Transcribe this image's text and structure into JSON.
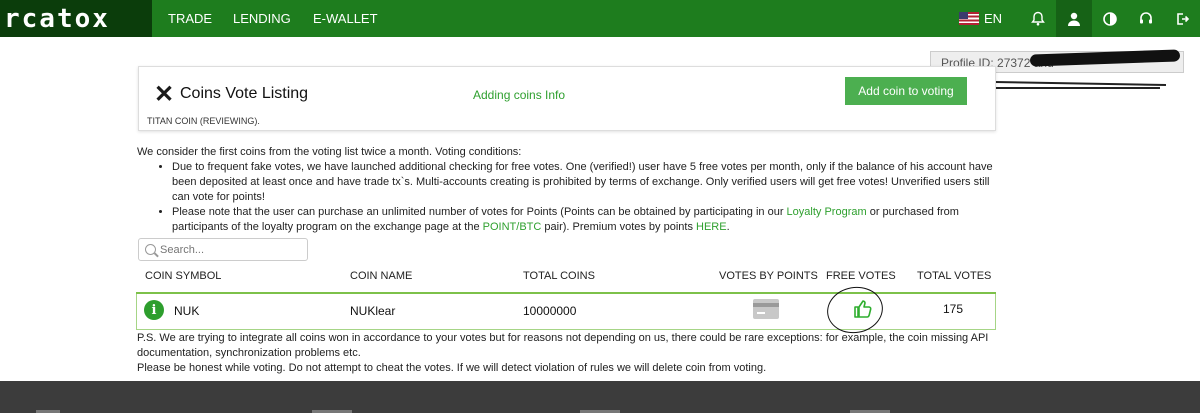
{
  "header": {
    "logo": "rcatox",
    "nav": [
      "TRADE",
      "LENDING",
      "E-WALLET"
    ],
    "lang": "EN",
    "icons": [
      "bell-icon",
      "user-icon",
      "contrast-icon",
      "headset-icon",
      "logout-icon"
    ]
  },
  "profile": {
    "text": "Profile ID: 27372 and"
  },
  "card": {
    "title": "Coins Vote Listing",
    "info_link": "Adding coins Info",
    "add_button": "Add coin to voting",
    "reviewing": "TITAN COIN (REVIEWING)."
  },
  "conditions": {
    "intro": "We consider the first coins from the voting list twice a month. Voting conditions:",
    "bullet1": "Due to frequent fake votes, we have launched additional checking for free votes. One (verified!) user have 5 free votes per month, only if the balance of his account have been deposited at least once and have trade tx`s. Multi-accounts creating is prohibited by terms of exchange. Only verified users will get free votes! Unverified users still can vote for points!",
    "bullet2_a": "Please note that the user can purchase an unlimited number of votes for Points (Points can be obtained by participating in our",
    "bullet2_link1": "Loyalty Program",
    "bullet2_b": "or purchased from participants of the loyalty program on the exchange page at the",
    "bullet2_link2": "POINT/BTC",
    "bullet2_c": "pair). Premium votes by points",
    "bullet2_link3": "HERE",
    "bullet2_d": "."
  },
  "search": {
    "placeholder": "Search..."
  },
  "table": {
    "headers": [
      "COIN SYMBOL",
      "COIN NAME",
      "TOTAL COINS",
      "VOTES BY POINTS",
      "FREE VOTES",
      "TOTAL VOTES"
    ],
    "row": {
      "symbol": "NUK",
      "name": "NUKlear",
      "total_coins": "10000000",
      "total_votes": "175"
    }
  },
  "ps": {
    "line1": "P.S. We are trying to integrate all coins won in accordance to your votes but for reasons not depending on us, there could be rare exceptions: for example, the coin missing API documentation, synchronization problems etc.",
    "line2": "Please be honest while voting. Do not attempt to cheat the votes. If we will detect violation of rules we will delete coin from voting."
  },
  "colors": {
    "brand_green": "#1e7d1e",
    "accent_green": "#4caf50",
    "footer": "#3c3c3c"
  }
}
